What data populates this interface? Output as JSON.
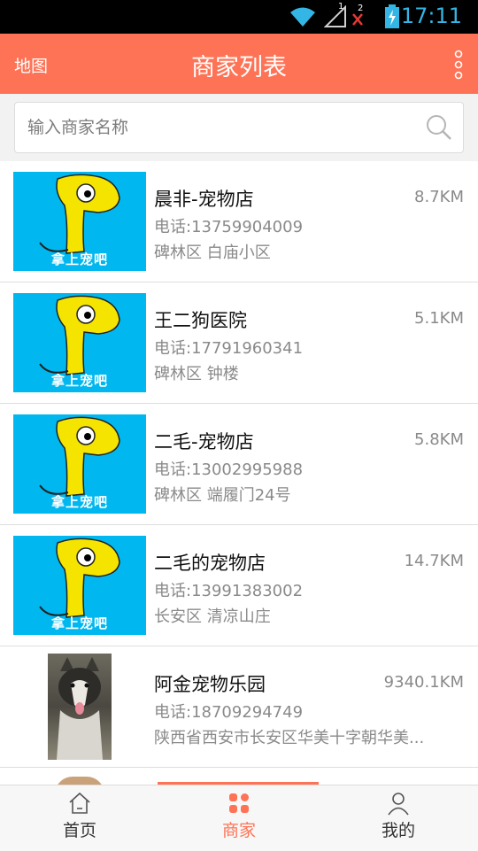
{
  "status_bar": {
    "time": "17:11",
    "sim1_label": "1",
    "sim2_label": "2"
  },
  "header": {
    "left_label": "地图",
    "title": "商家列表",
    "accent_color": "#fe7356"
  },
  "search": {
    "placeholder": "输入商家名称",
    "value": ""
  },
  "merchants": [
    {
      "name": "晨非-宠物店",
      "distance": "8.7KM",
      "phone": "电话:13759904009",
      "address": "碑林区 白庙小区",
      "image": "brand-logo",
      "brand": "拿上宠吧"
    },
    {
      "name": "王二狗医院",
      "distance": "5.1KM",
      "phone": "电话:17791960341",
      "address": "碑林区 钟楼",
      "image": "brand-logo",
      "brand": "拿上宠吧"
    },
    {
      "name": "二毛-宠物店",
      "distance": "5.8KM",
      "phone": "电话:13002995988",
      "address": "碑林区 端履门24号",
      "image": "brand-logo",
      "brand": "拿上宠吧"
    },
    {
      "name": "二毛的宠物店",
      "distance": "14.7KM",
      "phone": "电话:13991383002",
      "address": "长安区 清凉山庄",
      "image": "brand-logo",
      "brand": "拿上宠吧"
    },
    {
      "name": "阿金宠物乐园",
      "distance": "9340.1KM",
      "phone": "电话:18709294749",
      "address": "陕西省西安市长安区华美十字朝华美...",
      "image": "dog-photo"
    }
  ],
  "tabs": [
    {
      "label": "首页",
      "icon": "home-icon",
      "active": false
    },
    {
      "label": "商家",
      "icon": "grid-icon",
      "active": true
    },
    {
      "label": "我的",
      "icon": "user-icon",
      "active": false
    }
  ]
}
